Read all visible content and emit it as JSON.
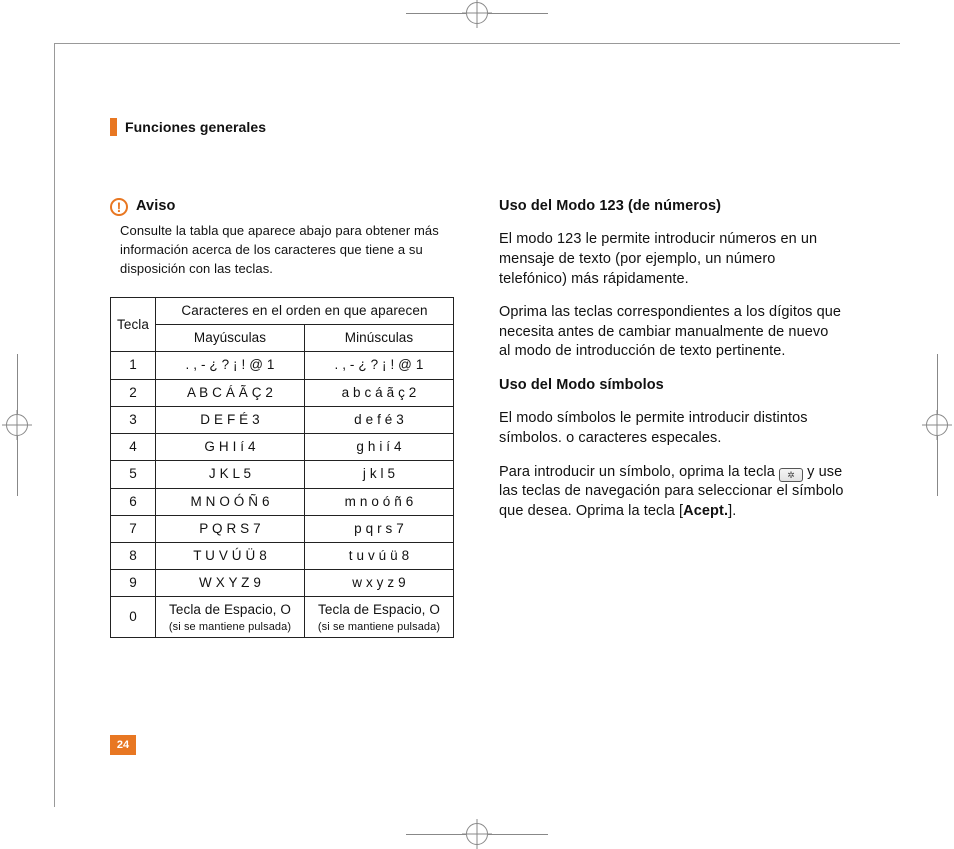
{
  "section_title": "Funciones generales",
  "notice": {
    "label": "Aviso",
    "body": "Consulte la tabla que aparece abajo para obtener más información acerca de los caracteres que tiene a su disposición con las teclas."
  },
  "table": {
    "col_key": "Tecla",
    "col_group": "Caracteres en el orden en que aparecen",
    "col_upper": "Mayúsculas",
    "col_lower": "Minúsculas",
    "rows": [
      {
        "key": "1",
        "upper": ". , - ¿ ? ¡ ! @ 1",
        "lower": ". , - ¿ ? ¡ ! @ 1"
      },
      {
        "key": "2",
        "upper": "A B C Á Ã Ç 2",
        "lower": "a b c á ã ç 2"
      },
      {
        "key": "3",
        "upper": "D E F É 3",
        "lower": "d e f é 3"
      },
      {
        "key": "4",
        "upper": "G H I í 4",
        "lower": "g h i í 4"
      },
      {
        "key": "5",
        "upper": "J K L 5",
        "lower": "j k l 5"
      },
      {
        "key": "6",
        "upper": "M N O Ó Ñ 6",
        "lower": "m n o ó ñ 6"
      },
      {
        "key": "7",
        "upper": "P Q R S 7",
        "lower": "p q r s 7"
      },
      {
        "key": "8",
        "upper": "T U V Ú Ü 8",
        "lower": "t u v ú ü 8"
      },
      {
        "key": "9",
        "upper": "W X Y Z 9",
        "lower": "w x y z 9"
      }
    ],
    "zero": {
      "key": "0",
      "line1": "Tecla de Espacio, O",
      "line2": "(si se mantiene pulsada)"
    }
  },
  "right": {
    "h1": "Uso del Modo 123 (de números)",
    "p1": "El modo 123 le permite introducir números en un mensaje de texto (por ejemplo, un número telefónico) más rápidamente.",
    "p2": "Oprima las teclas correspondientes a los dígitos que necesita antes de cambiar manualmente de nuevo al modo de introducción de texto pertinente.",
    "h2": "Uso del Modo símbolos",
    "p3": "El modo símbolos le permite introducir distintos símbolos. o caracteres especales.",
    "p4a": "Para introducir un símbolo, oprima la tecla ",
    "p4b": " y use las teclas de navegación para seleccionar el símbolo que desea. Oprima la tecla [",
    "accept": "Acept.",
    "p4c": "]."
  },
  "page_number": "24"
}
